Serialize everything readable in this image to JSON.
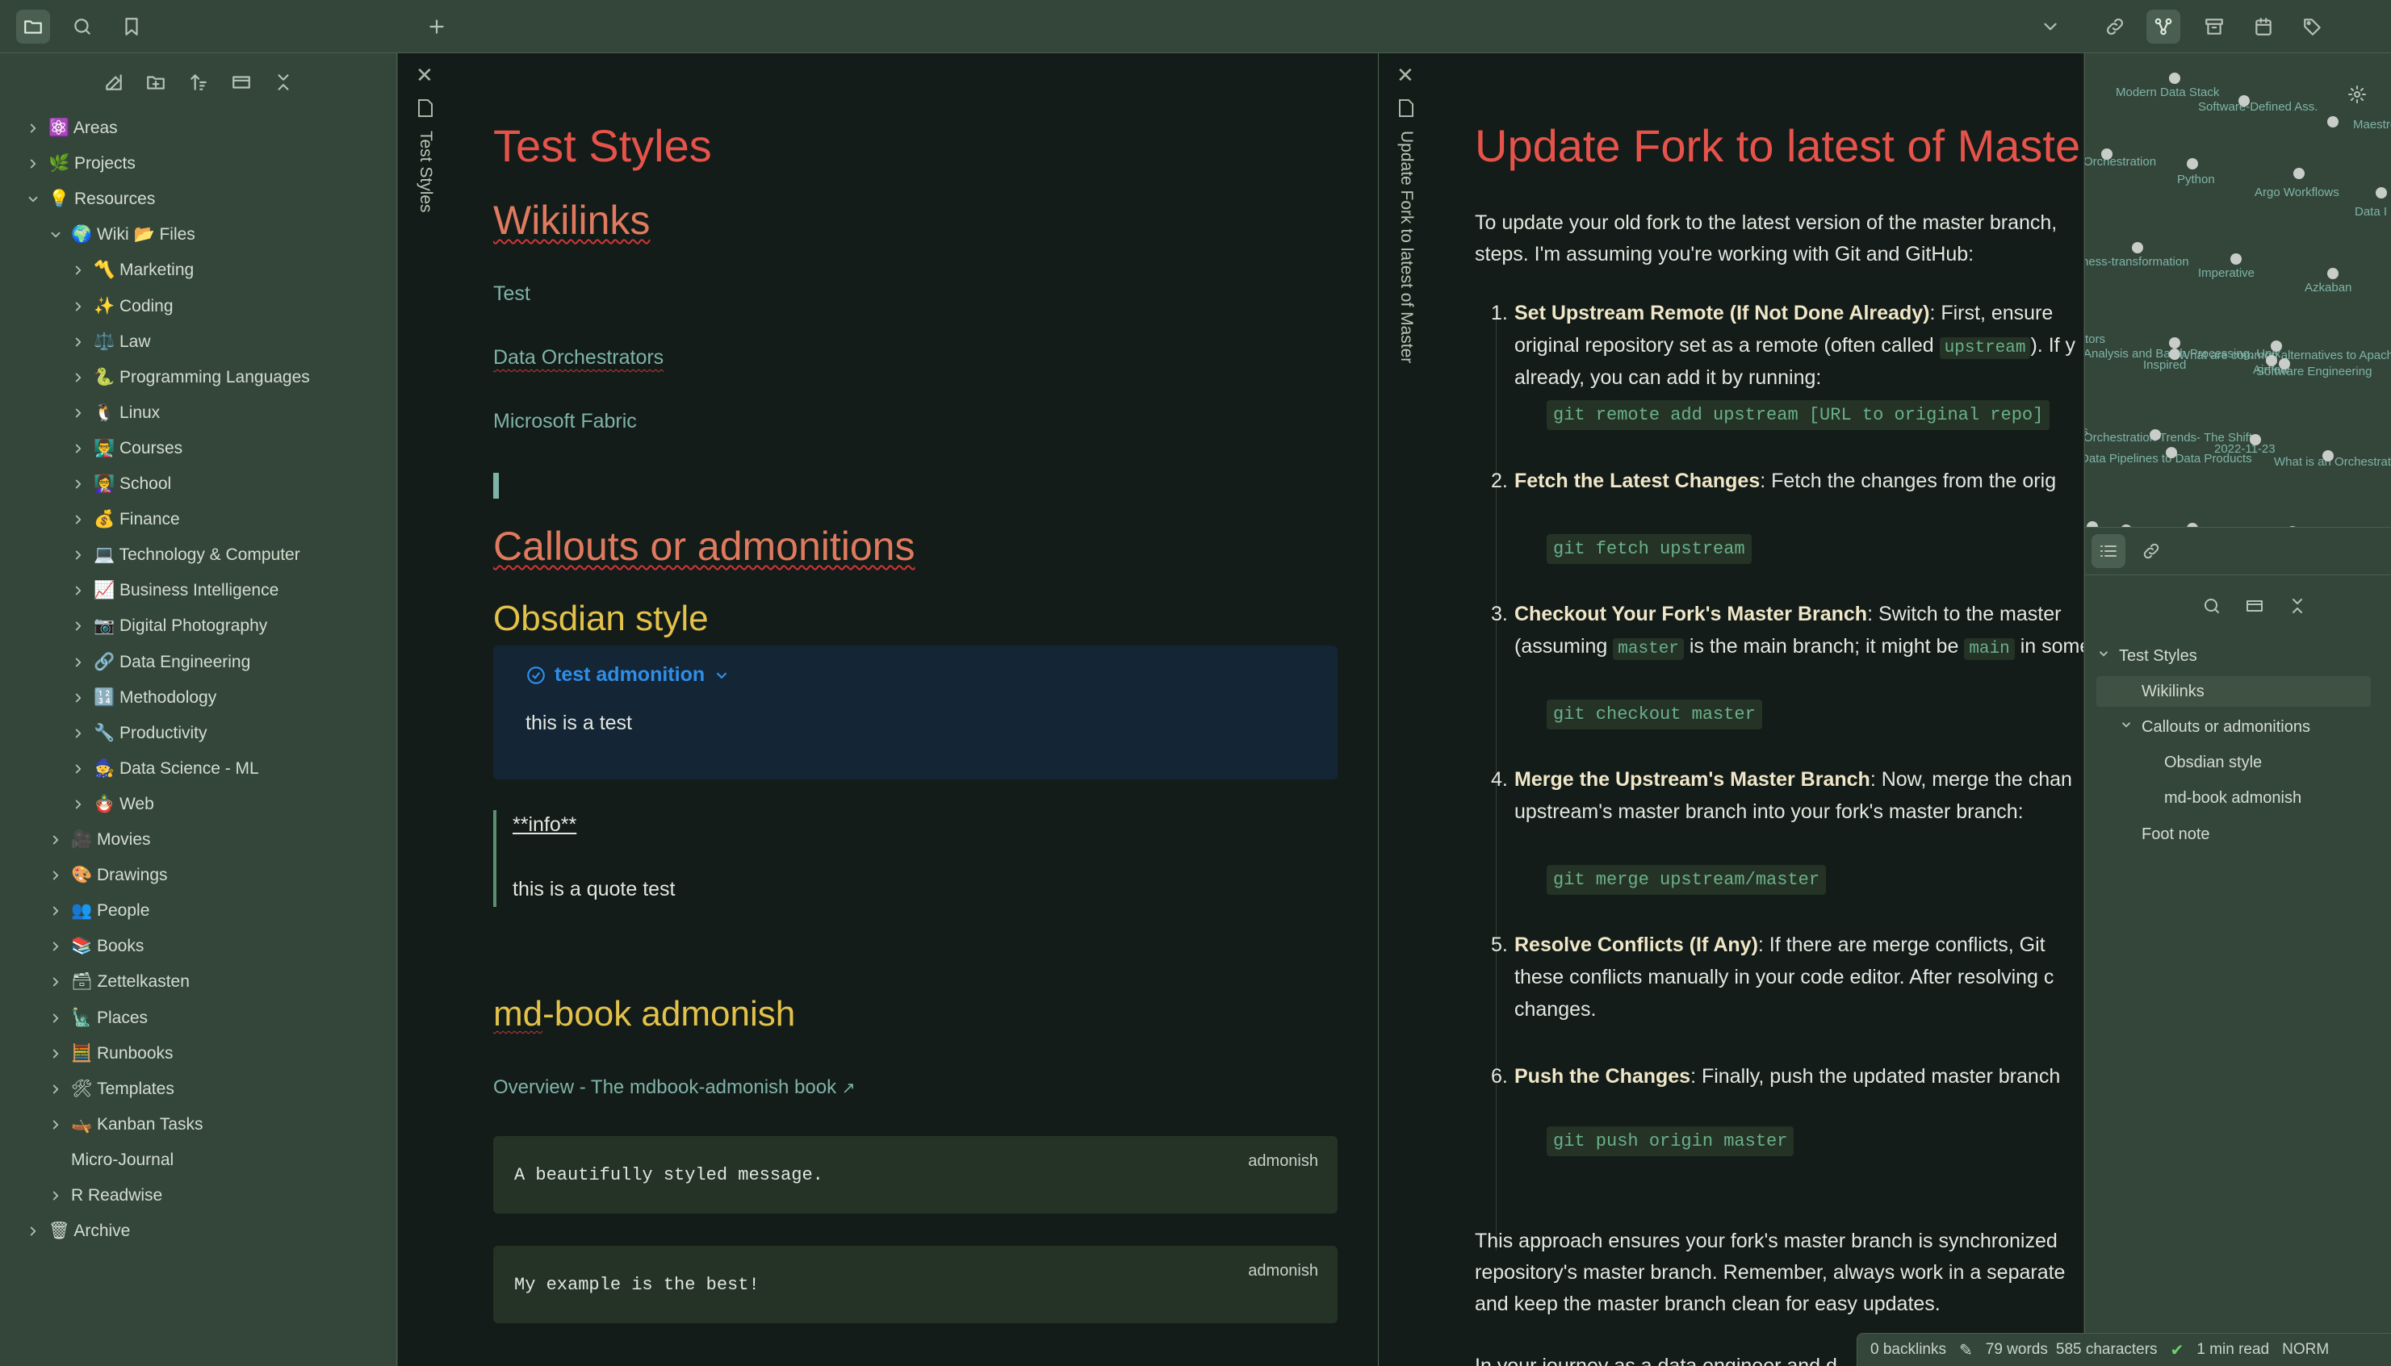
{
  "topbar": {
    "icons": [
      "folder-icon",
      "search-icon",
      "bookmark-icon",
      "plus-icon",
      "chevron-down-icon",
      "link-icon",
      "graph-icon",
      "archive-icon",
      "calendar-icon",
      "tags-icon"
    ]
  },
  "sidebar": {
    "tools": [
      "new-note-icon",
      "new-folder-icon",
      "sort-icon",
      "collapse-view-icon",
      "collapse-all-icon"
    ],
    "items": [
      {
        "label": "⚛️ Areas",
        "depth": 0,
        "state": "closed"
      },
      {
        "label": "🌿 Projects",
        "depth": 0,
        "state": "closed"
      },
      {
        "label": "💡 Resources",
        "depth": 0,
        "state": "open"
      },
      {
        "label": "🌍 Wiki 📂 Files",
        "depth": 1,
        "state": "open"
      },
      {
        "label": "〽️ Marketing",
        "depth": 2,
        "state": "closed"
      },
      {
        "label": "✨ Coding",
        "depth": 2,
        "state": "closed"
      },
      {
        "label": "⚖️ Law",
        "depth": 2,
        "state": "closed"
      },
      {
        "label": "🐍 Programming Languages",
        "depth": 2,
        "state": "closed"
      },
      {
        "label": "🐧 Linux",
        "depth": 2,
        "state": "closed"
      },
      {
        "label": "👨‍🏫 Courses",
        "depth": 2,
        "state": "closed"
      },
      {
        "label": "👩‍🏫 School",
        "depth": 2,
        "state": "closed"
      },
      {
        "label": "💰 Finance",
        "depth": 2,
        "state": "closed"
      },
      {
        "label": "💻 Technology & Computer",
        "depth": 2,
        "state": "closed"
      },
      {
        "label": "📈 Business Intelligence",
        "depth": 2,
        "state": "closed"
      },
      {
        "label": "📷 Digital Photography",
        "depth": 2,
        "state": "closed"
      },
      {
        "label": "🔗 Data Engineering",
        "depth": 2,
        "state": "closed"
      },
      {
        "label": "🔢 Methodology",
        "depth": 2,
        "state": "closed"
      },
      {
        "label": "🔧 Productivity",
        "depth": 2,
        "state": "closed"
      },
      {
        "label": "🧙 Data Science - ML",
        "depth": 2,
        "state": "closed"
      },
      {
        "label": "🪆 Web",
        "depth": 2,
        "state": "closed"
      },
      {
        "label": "🎥 Movies",
        "depth": 1,
        "state": "closed"
      },
      {
        "label": "🎨 Drawings",
        "depth": 1,
        "state": "closed"
      },
      {
        "label": "👥 People",
        "depth": 1,
        "state": "closed"
      },
      {
        "label": "📚 Books",
        "depth": 1,
        "state": "closed"
      },
      {
        "label": "🗃 Zettelkasten",
        "depth": 1,
        "state": "closed"
      },
      {
        "label": "🗽 Places",
        "depth": 1,
        "state": "closed"
      },
      {
        "label": "🧮 Runbooks",
        "depth": 1,
        "state": "closed"
      },
      {
        "label": "🛠 Templates",
        "depth": 1,
        "state": "closed"
      },
      {
        "label": "🛶 Kanban Tasks",
        "depth": 1,
        "state": "closed"
      },
      {
        "label": "Micro-Journal",
        "depth": 1,
        "state": "none"
      },
      {
        "label": "R Readwise",
        "depth": 1,
        "state": "closed"
      },
      {
        "label": "🗑 Archive",
        "depth": 0,
        "state": "closed"
      }
    ]
  },
  "pane1": {
    "tab_title": "Test Styles",
    "title": "Test Styles",
    "h_wikilinks": "Wikilinks",
    "links": [
      "Test",
      "Data Orchestrators",
      "Microsoft Fabric"
    ],
    "h_callouts": "Callouts or admonitions",
    "h_obsidian": "Obsdian style",
    "callout_title": "test admonition",
    "callout_body": "this is a test",
    "quote_title": "**info**",
    "quote_body": "this is a quote test",
    "h_mdbook": "md-book admonish",
    "overview_link": "Overview - The mdbook-admonish book",
    "code1": "A beautifully styled message.",
    "code2": "My example is the best!",
    "code_tag": "admonish"
  },
  "pane2": {
    "tab_title": "Update Fork to latest of Master",
    "title": "Update Fork to latest of Master",
    "intro_line1": "To update your old fork to the latest version of the master branch,",
    "intro_line2": "steps. I'm assuming you're working with Git and GitHub:",
    "steps": [
      {
        "num": "1.",
        "bold": "Set Upstream Remote (If Not Done Already)",
        "rest1": ": First, ensure",
        "line2": "original repository set as a remote (often called",
        "icode": "upstream",
        "line2b": "). If y",
        "line3": "already, you can add it by running:",
        "code": "git remote add upstream [URL to original repo]"
      },
      {
        "num": "2.",
        "bold": "Fetch the Latest Changes",
        "rest1": ": Fetch the changes from the orig",
        "code": "git fetch upstream"
      },
      {
        "num": "3.",
        "bold": "Checkout Your Fork's Master Branch",
        "rest1": ": Switch to the master",
        "line2a": "(assuming",
        "icode1": "master",
        "line2b": "is the main branch; it might be",
        "icode2": "main",
        "line2c": "in some",
        "code": "git checkout master"
      },
      {
        "num": "4.",
        "bold": "Merge the Upstream's Master Branch",
        "rest1": ": Now, merge the chan",
        "line2": "upstream's master branch into your fork's master branch:",
        "code": "git merge upstream/master"
      },
      {
        "num": "5.",
        "bold": "Resolve Conflicts (If Any)",
        "rest1": ": If there are merge conflicts, Git",
        "line2": "these conflicts manually in your code editor. After resolving c",
        "line3": "changes."
      },
      {
        "num": "6.",
        "bold": "Push the Changes",
        "rest1": ": Finally, push the updated master branch",
        "code": "git push origin master"
      }
    ],
    "outro_line1": "This approach ensures your fork's master branch is synchronized",
    "outro_line2": "repository's master branch. Remember, always work in a separate",
    "outro_line3": "and keep the master branch clean for easy updates.",
    "outro_line4": "In your journey as a data engineer and d"
  },
  "graph": {
    "labels": [
      "Modern Data Stack",
      "Software-Defined Ass.",
      "Maestro",
      "Orchestration",
      "Python",
      "Argo Workflows",
      "Data I",
      "ness-transformation",
      "Imperative",
      "Azkaban",
      "Analysis and Batch Processing, Unix",
      "Inspired",
      "What are common alternatives to Apache",
      "Airflow",
      "Software Engineering",
      "Orchestration Trends- The Shift",
      "2022-11-23",
      "Data Pipelines to Data Products",
      "What is an Orchestrat",
      "tors",
      "ts"
    ]
  },
  "outline": {
    "items": [
      {
        "label": "Test Styles",
        "depth": 0,
        "chev": true
      },
      {
        "label": "Wikilinks",
        "depth": 1,
        "chev": false,
        "active": true
      },
      {
        "label": "Callouts or admonitions",
        "depth": 1,
        "chev": true
      },
      {
        "label": "Obsdian style",
        "depth": 2,
        "chev": false
      },
      {
        "label": "md-book admonish",
        "depth": 2,
        "chev": false
      },
      {
        "label": "Foot note",
        "depth": 1,
        "chev": false
      }
    ]
  },
  "statusbar": {
    "backlinks": "0 backlinks",
    "words": "79 words",
    "chars": "585 characters",
    "read": "1 min read",
    "mode": "NORM"
  }
}
